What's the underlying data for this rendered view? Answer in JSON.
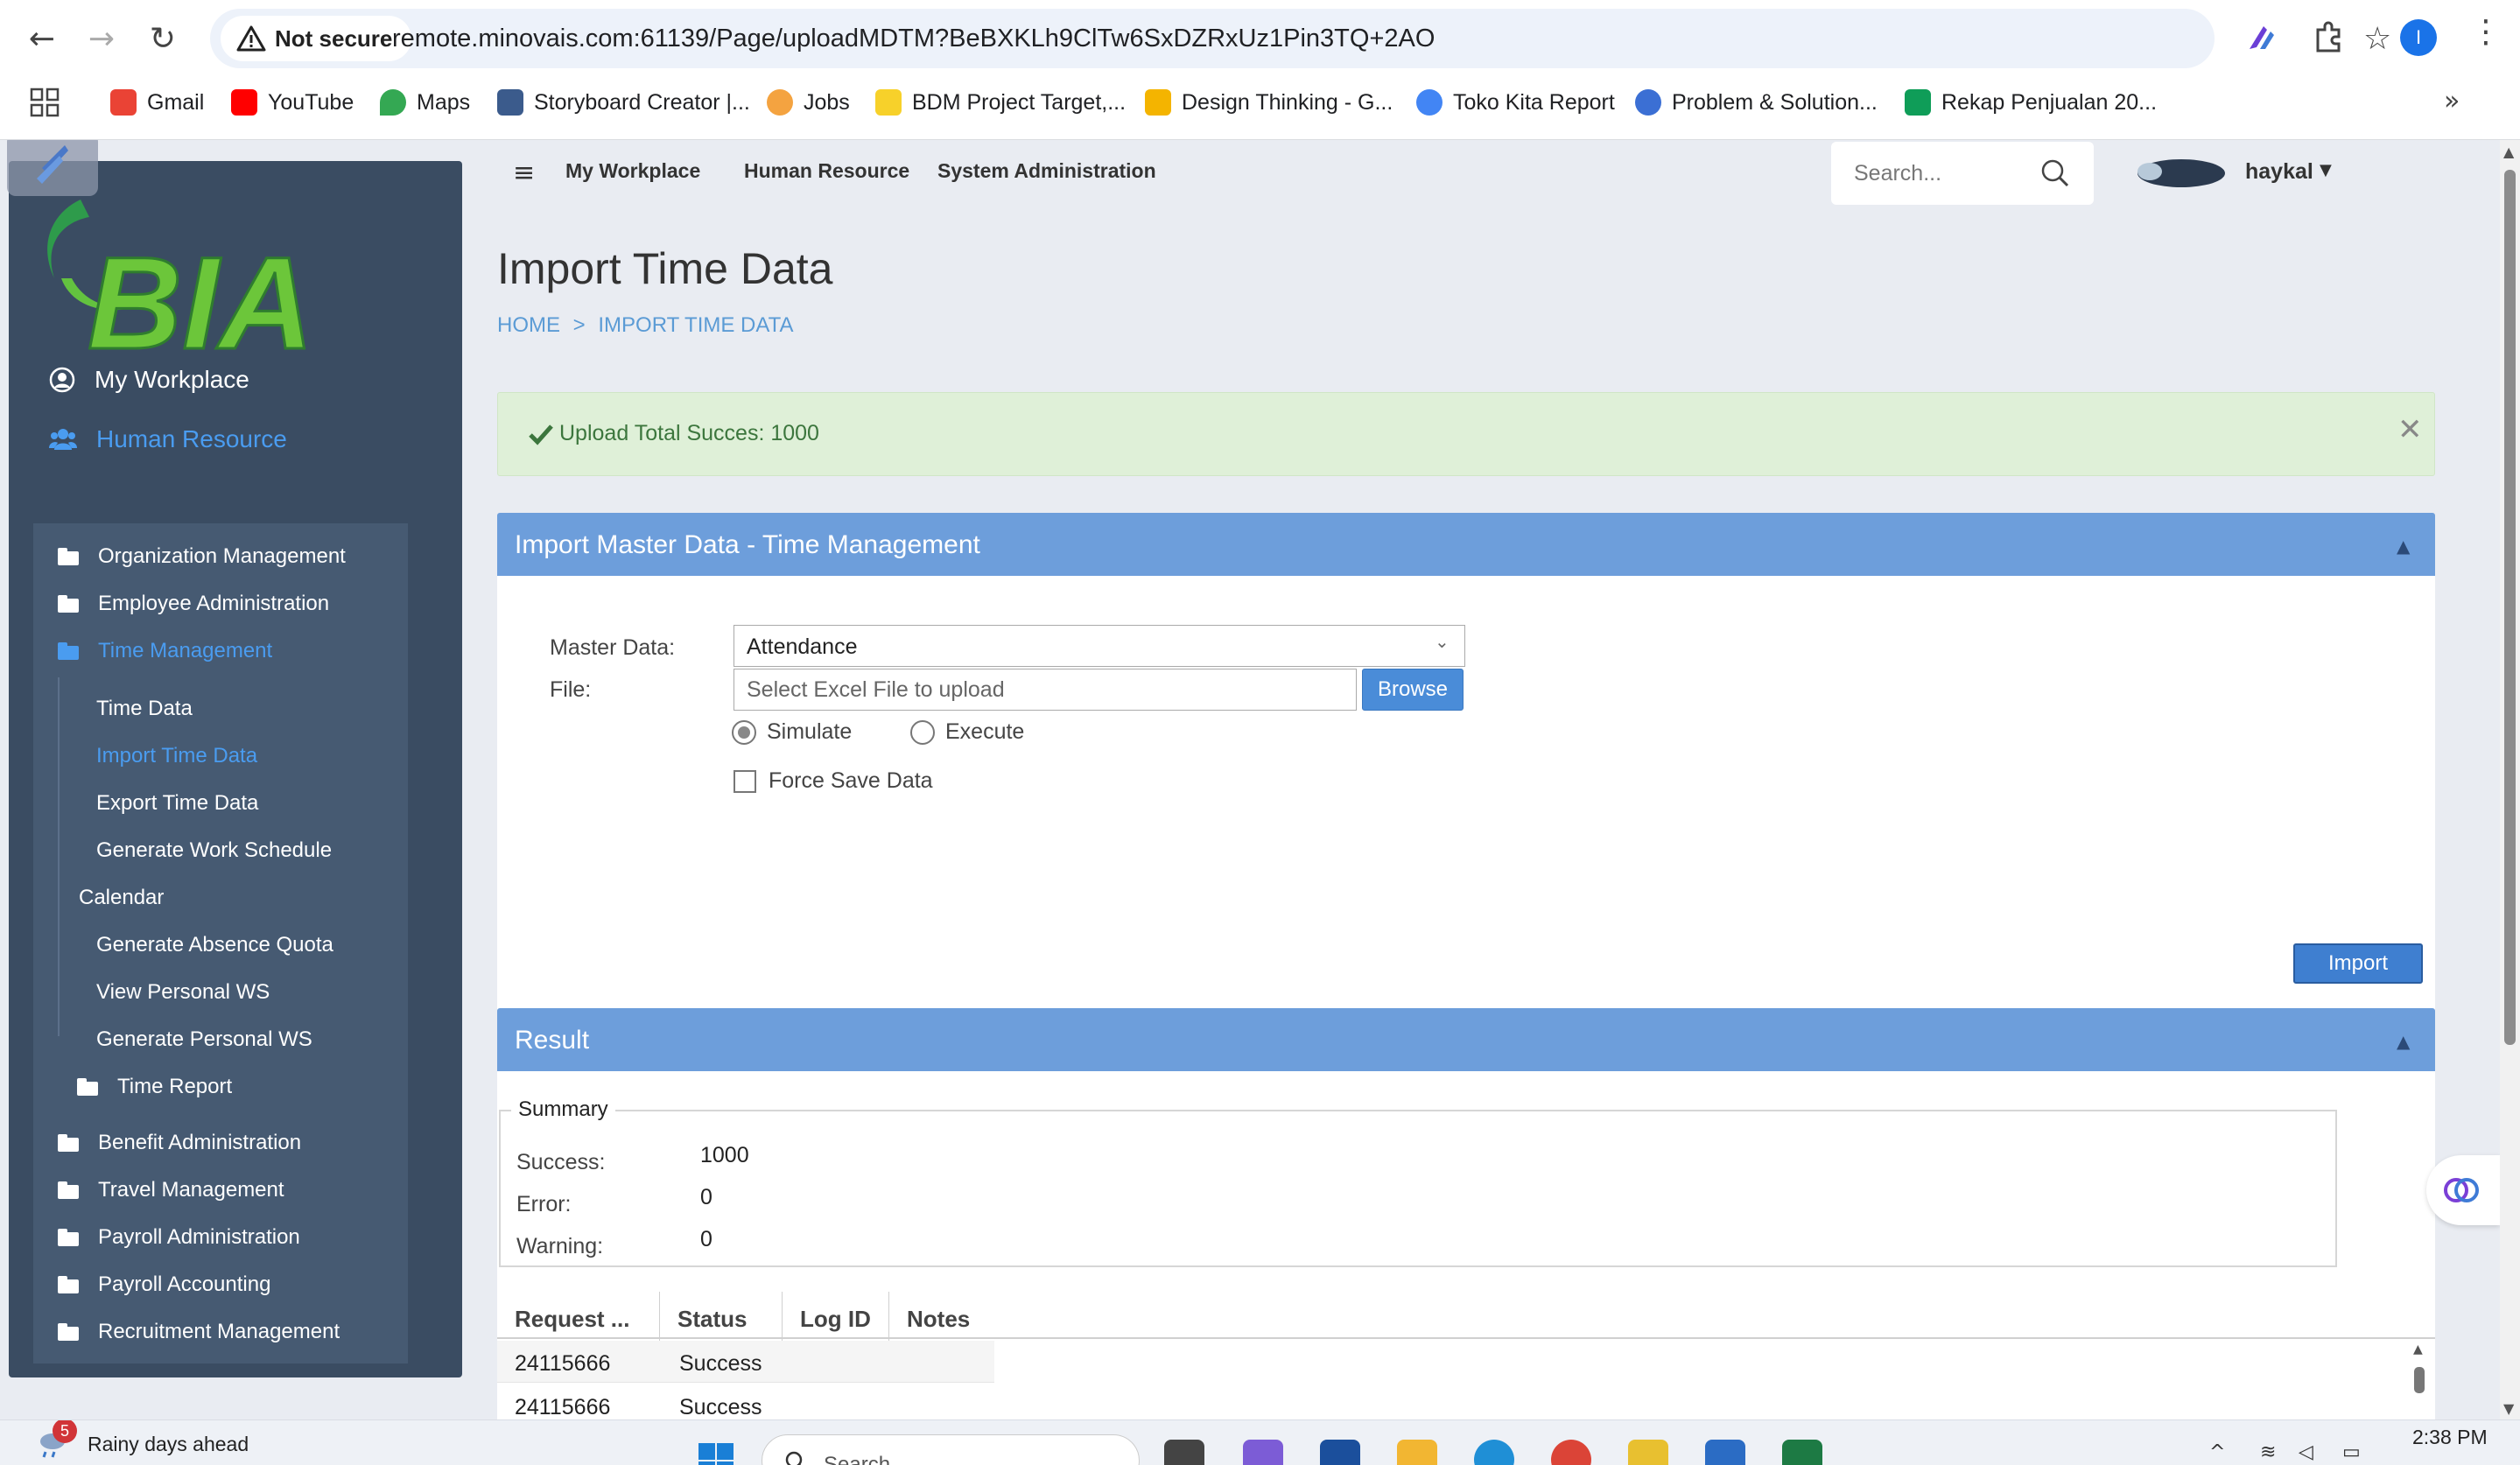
{
  "browser": {
    "security_label": "Not secure",
    "url": "remote.minovais.com:61139/Page/uploadMDTM?BeBXKLh9ClTw6SxDZRxUz1Pin3TQ+2AO",
    "profile_initial": "I",
    "bookmarks": [
      {
        "label": "Gmail",
        "color": "#ea4335"
      },
      {
        "label": "YouTube",
        "color": "#ff0000"
      },
      {
        "label": "Maps",
        "color": "#34a853"
      },
      {
        "label": "Storyboard Creator |...",
        "color": "#3b5b8c"
      },
      {
        "label": "Jobs",
        "color": "#f4a340"
      },
      {
        "label": "BDM Project Target,...",
        "color": "#1c1c1c"
      },
      {
        "label": "Design Thinking - G...",
        "color": "#f4b400"
      },
      {
        "label": "Toko Kita Report",
        "color": "#4285f4"
      },
      {
        "label": "Problem & Solution...",
        "color": "#3b6fd4"
      },
      {
        "label": "Rekap Penjualan 20...",
        "color": "#0f9d58"
      }
    ]
  },
  "sidebar": {
    "brand": "BIA",
    "top_items": [
      {
        "label": "My Workplace",
        "icon": "user-circle-icon"
      },
      {
        "label": "Human Resource",
        "icon": "users-icon",
        "active": true
      }
    ],
    "submenu": {
      "org": "Organization Management",
      "emp": "Employee Administration",
      "tm": "Time Management",
      "tm_children": [
        "Time Data",
        "Import Time Data",
        "Export Time Data",
        "Generate Work Schedule"
      ],
      "calendar": "Calendar",
      "cal_children": [
        "Generate Absence Quota",
        "View Personal WS",
        "Generate Personal WS"
      ],
      "time_report": "Time Report",
      "rest": [
        "Benefit Administration",
        "Travel Management",
        "Payroll Administration",
        "Payroll Accounting",
        "Recruitment Management"
      ]
    }
  },
  "topnav": {
    "links": [
      "My Workplace",
      "Human Resource",
      "System Administration"
    ],
    "search_placeholder": "Search...",
    "user_name": "haykal"
  },
  "page": {
    "title": "Import Time Data",
    "breadcrumb": {
      "home": "HOME",
      "sep": ">",
      "current": "IMPORT TIME DATA"
    },
    "alert": "Upload Total Succes: 1000",
    "import_panel": {
      "title": "Import Master Data - Time Management",
      "master_data_label": "Master Data:",
      "master_data_value": "Attendance",
      "file_label": "File:",
      "file_placeholder": "Select Excel File to upload",
      "browse_label": "Browse",
      "radio_simulate": "Simulate",
      "radio_execute": "Execute",
      "selected_mode": "Simulate",
      "force_save_label": "Force Save Data",
      "force_save_checked": false,
      "import_label": "Import"
    },
    "result_panel": {
      "title": "Result",
      "summary_legend": "Summary",
      "summary": [
        {
          "label": "Success:",
          "value": "1000"
        },
        {
          "label": "Error:",
          "value": "0"
        },
        {
          "label": "Warning:",
          "value": "0"
        }
      ],
      "columns": [
        "Request ...",
        "Status",
        "Log ID",
        "Notes"
      ],
      "rows": [
        {
          "request": "24115666",
          "status": "Success"
        },
        {
          "request": "24115666",
          "status": "Success"
        }
      ]
    }
  },
  "taskbar": {
    "weather_badge": "5",
    "weather_text": "Rainy days ahead",
    "search_text": "Search",
    "time": "2:38 PM"
  },
  "colors": {
    "sidebar_bg": "#3a4c62",
    "accent_blue": "#4a9cf0",
    "panel_header": "#6d9edb",
    "alert_bg": "#dff0d8",
    "alert_text": "#3c763d"
  }
}
